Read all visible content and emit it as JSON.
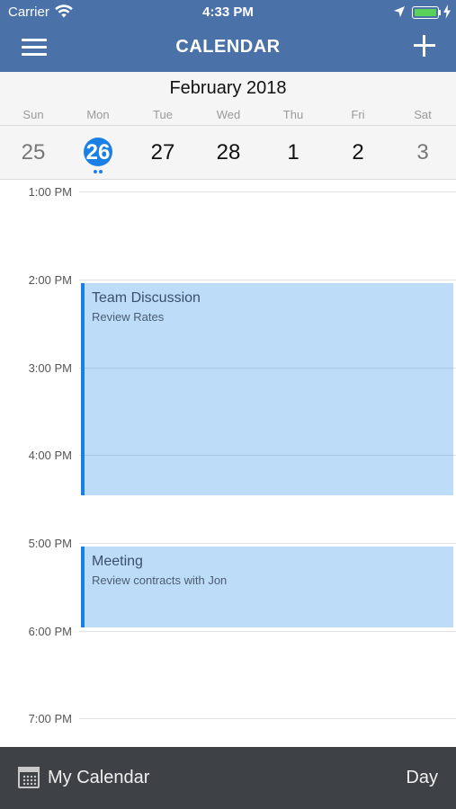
{
  "status_bar": {
    "carrier": "Carrier",
    "time": "4:33 PM",
    "battery_color": "#5ad25a"
  },
  "nav": {
    "menu_icon": "hamburger-menu-icon",
    "title": "CALENDAR",
    "add_icon": "plus-icon"
  },
  "week": {
    "month_label": "February 2018",
    "day_names": [
      "Sun",
      "Mon",
      "Tue",
      "Wed",
      "Thu",
      "Fri",
      "Sat"
    ],
    "dates": [
      "25",
      "26",
      "27",
      "28",
      "1",
      "2",
      "3"
    ],
    "selected_index": 1,
    "selected_event_dots": 2
  },
  "timeline": {
    "hours": [
      "1:00 PM",
      "2:00 PM",
      "3:00 PM",
      "4:00 PM",
      "5:00 PM",
      "6:00 PM",
      "7:00 PM"
    ],
    "events": [
      {
        "title": "Team Discussion",
        "subtitle": "Review Rates"
      },
      {
        "title": "Meeting",
        "subtitle": "Review contracts with Jon"
      }
    ]
  },
  "bottom_bar": {
    "calendar_icon": "calendar-icon",
    "calendar_name": "My Calendar",
    "view_mode": "Day"
  },
  "colors": {
    "header": "#4a72a8",
    "accent": "#1a80e5",
    "event_fill": "#bcdcf7",
    "bottom_bar": "#3e4247"
  }
}
